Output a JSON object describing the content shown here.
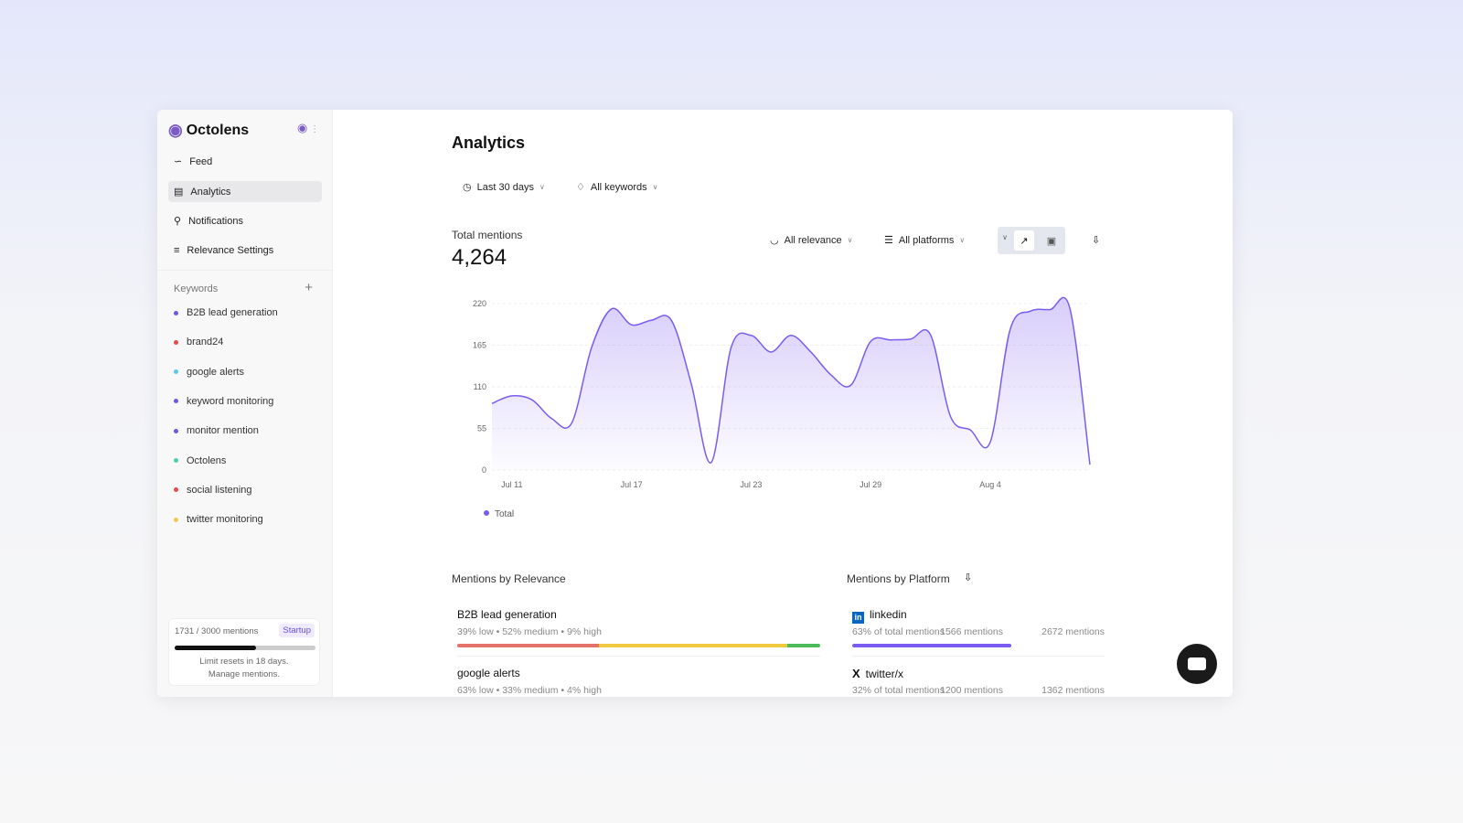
{
  "app": {
    "name": "Octolens"
  },
  "sidebar": {
    "items": [
      {
        "label": "Feed"
      },
      {
        "label": "Analytics"
      },
      {
        "label": "Notifications"
      },
      {
        "label": "Relevance Settings"
      }
    ],
    "keywords_label": "Keywords",
    "keywords": [
      {
        "label": "B2B lead generation",
        "color": "#6a5ae0"
      },
      {
        "label": "brand24",
        "color": "#e24b4b"
      },
      {
        "label": "google alerts",
        "color": "#5bc8e6"
      },
      {
        "label": "keyword monitoring",
        "color": "#6a5ae0"
      },
      {
        "label": "monitor mention",
        "color": "#6a5ae0"
      },
      {
        "label": "Octolens",
        "color": "#4ecdb0"
      },
      {
        "label": "social listening",
        "color": "#e24b4b"
      },
      {
        "label": "twitter monitoring",
        "color": "#f2c94c"
      }
    ],
    "usage": {
      "text": "1731 / 3000 mentions",
      "plan": "Startup",
      "used": 1731,
      "limit": 3000,
      "reset": "Limit resets in 18 days.",
      "manage": "Manage mentions."
    }
  },
  "main": {
    "title": "Analytics",
    "filters": {
      "range": "Last 30 days",
      "keywords": "All keywords",
      "relevance": "All relevance",
      "platforms": "All platforms"
    },
    "total_label": "Total mentions",
    "total_value": "4,264",
    "legend": "Total",
    "relevance": {
      "title": "Mentions by Relevance",
      "rows": [
        {
          "name": "B2B lead generation",
          "detail": "39% low • 52% medium • 9% high",
          "count": "1566 mentions",
          "low": 39,
          "medium": 52,
          "high": 9
        },
        {
          "name": "google alerts",
          "detail": "63% low • 33% medium • 4% high",
          "count": "1200 mentions",
          "low": 63,
          "medium": 33,
          "high": 4
        }
      ]
    },
    "platform": {
      "title": "Mentions by Platform",
      "rows": [
        {
          "name": "linkedin",
          "detail": "63% of total mentions",
          "count": "2672 mentions",
          "pct": 63
        },
        {
          "name": "twitter/x",
          "detail": "32% of total mentions",
          "count": "1362 mentions",
          "pct": 32
        }
      ]
    }
  },
  "chart_data": {
    "type": "area",
    "series": [
      {
        "name": "Total",
        "color": "#7b5cf0",
        "values": [
          88,
          98,
          93,
          68,
          62,
          162,
          213,
          192,
          198,
          198,
          114,
          10,
          162,
          178,
          156,
          178,
          156,
          126,
          112,
          170,
          172,
          173,
          179,
          71,
          53,
          37,
          186,
          210,
          212,
          213,
          7
        ]
      }
    ],
    "x_start": "Jul 10",
    "x_ticks": [
      {
        "label": "Jul 11",
        "index": 1
      },
      {
        "label": "Jul 17",
        "index": 7
      },
      {
        "label": "Jul 23",
        "index": 13
      },
      {
        "label": "Jul 29",
        "index": 19
      },
      {
        "label": "Aug 4",
        "index": 25
      }
    ],
    "y_ticks": [
      "0",
      "55",
      "110",
      "165",
      "220"
    ],
    "ylim": [
      0,
      220
    ],
    "grid": true,
    "legend": "bottom-left"
  }
}
